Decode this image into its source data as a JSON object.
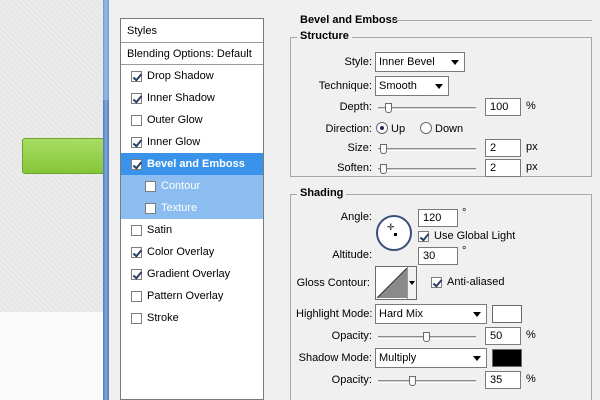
{
  "styles_list": {
    "header": "Styles",
    "blending_options": "Blending Options: Default",
    "items": [
      {
        "label": "Drop Shadow",
        "checked": true
      },
      {
        "label": "Inner Shadow",
        "checked": true
      },
      {
        "label": "Outer Glow",
        "checked": false
      },
      {
        "label": "Inner Glow",
        "checked": true
      },
      {
        "label": "Bevel and Emboss",
        "checked": true
      },
      {
        "label": "Contour",
        "checked": false
      },
      {
        "label": "Texture",
        "checked": false
      },
      {
        "label": "Satin",
        "checked": false
      },
      {
        "label": "Color Overlay",
        "checked": true
      },
      {
        "label": "Gradient Overlay",
        "checked": true
      },
      {
        "label": "Pattern Overlay",
        "checked": false
      },
      {
        "label": "Stroke",
        "checked": false
      }
    ]
  },
  "bevel": {
    "title": "Bevel and Emboss",
    "structure": {
      "title": "Structure",
      "style_label": "Style:",
      "style_value": "Inner Bevel",
      "technique_label": "Technique:",
      "technique_value": "Smooth",
      "depth_label": "Depth:",
      "depth_value": "100",
      "depth_unit": "%",
      "depth_slider": 0.08,
      "direction_label": "Direction:",
      "direction_up": "Up",
      "direction_down": "Down",
      "size_label": "Size:",
      "size_value": "2",
      "size_unit": "px",
      "size_slider": 0.02,
      "soften_label": "Soften:",
      "soften_value": "2",
      "soften_unit": "px",
      "soften_slider": 0.02
    },
    "shading": {
      "title": "Shading",
      "angle_label": "Angle:",
      "angle_value": "120",
      "angle_unit": "°",
      "global_light_label": "Use Global Light",
      "altitude_label": "Altitude:",
      "altitude_value": "30",
      "altitude_unit": "°",
      "gloss_contour_label": "Gloss Contour:",
      "anti_aliased_label": "Anti-aliased",
      "highlight_mode_label": "Highlight Mode:",
      "highlight_mode_value": "Hard Mix",
      "highlight_color": "#ffffff",
      "highlight_opacity_label": "Opacity:",
      "highlight_opacity_value": "50",
      "highlight_opacity_unit": "%",
      "highlight_opacity_slider": 0.5,
      "shadow_mode_label": "Shadow Mode:",
      "shadow_mode_value": "Multiply",
      "shadow_color": "#000000",
      "shadow_opacity_label": "Opacity:",
      "shadow_opacity_value": "35",
      "shadow_opacity_unit": "%",
      "shadow_opacity_slider": 0.35
    }
  }
}
